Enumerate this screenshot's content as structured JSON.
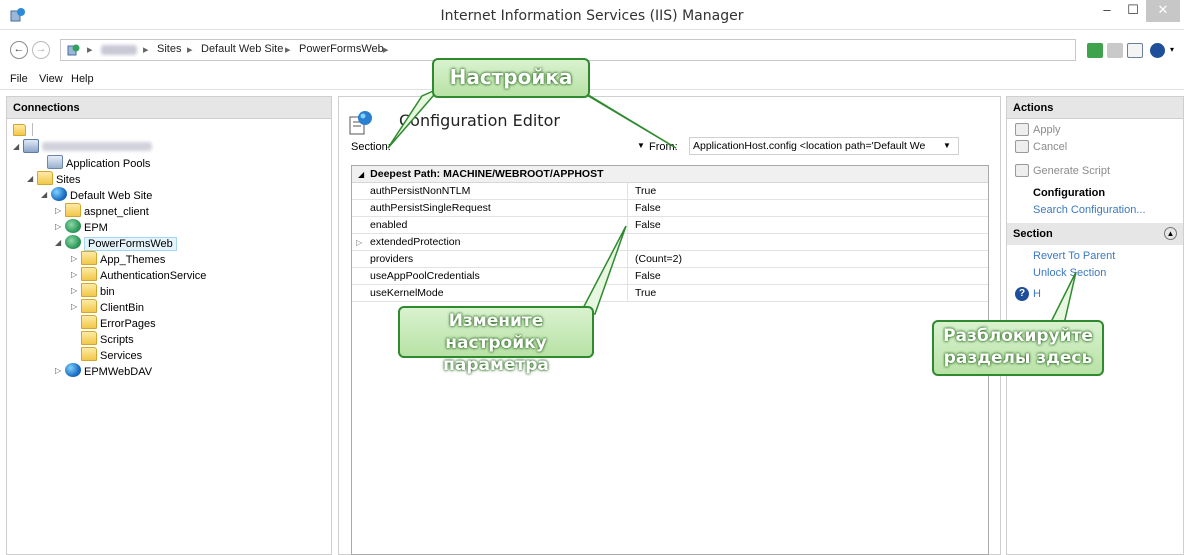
{
  "window": {
    "title": "Internet Information Services (IIS) Manager",
    "min": "–",
    "max": "☐",
    "close": "✕"
  },
  "address": {
    "crumbs": [
      "Sites",
      "Default Web Site",
      "PowerFormsWeb"
    ],
    "separator": "▸"
  },
  "menu": [
    "File",
    "View",
    "Help"
  ],
  "connections": {
    "header": "Connections",
    "tree": [
      {
        "label": "Application Pools",
        "icon": "pool"
      },
      {
        "label": "Sites",
        "icon": "folder"
      },
      {
        "label": "Default Web Site",
        "icon": "globe"
      },
      {
        "label": "aspnet_client",
        "icon": "folder"
      },
      {
        "label": "EPM",
        "icon": "webapp"
      },
      {
        "label": "PowerFormsWeb",
        "icon": "webapp"
      },
      {
        "label": "App_Themes",
        "icon": "folder"
      },
      {
        "label": "AuthenticationService",
        "icon": "folder"
      },
      {
        "label": "bin",
        "icon": "folder"
      },
      {
        "label": "ClientBin",
        "icon": "folder"
      },
      {
        "label": "ErrorPages",
        "icon": "folder"
      },
      {
        "label": "Scripts",
        "icon": "folder"
      },
      {
        "label": "Services",
        "icon": "folder"
      },
      {
        "label": "EPMWebDAV",
        "icon": "globe"
      }
    ]
  },
  "editor": {
    "title": "Configuration Editor",
    "section_label": "Section:",
    "from_label": "From:",
    "from_value": "ApplicationHost.config <location path='Default We",
    "group_header": "Deepest Path: MACHINE/WEBROOT/APPHOST",
    "rows": [
      {
        "key": "authPersistNonNTLM",
        "value": "True"
      },
      {
        "key": "authPersistSingleRequest",
        "value": "False"
      },
      {
        "key": "enabled",
        "value": "False"
      },
      {
        "key": "extendedProtection",
        "value": ""
      },
      {
        "key": "providers",
        "value": "(Count=2)"
      },
      {
        "key": "useAppPoolCredentials",
        "value": "False"
      },
      {
        "key": "useKernelMode",
        "value": "True"
      }
    ]
  },
  "actions": {
    "header": "Actions",
    "apply": "Apply",
    "cancel": "Cancel",
    "generate_script": "Generate Script",
    "configuration": "Configuration",
    "search_configuration": "Search Configuration...",
    "section_header": "Section",
    "revert_to_parent": "Revert To Parent",
    "unlock_section": "Unlock Section",
    "help": "H"
  },
  "callouts": {
    "setting": "Настройка",
    "change_line1": "Измените настройку",
    "change_line2": "параметра",
    "unlock_line1": "Разблокируйте",
    "unlock_line2": "разделы здесь"
  },
  "colors": {
    "callout_border": "#2f8a2f",
    "link": "#3c79c3",
    "panel_header": "#e6e6e6"
  }
}
